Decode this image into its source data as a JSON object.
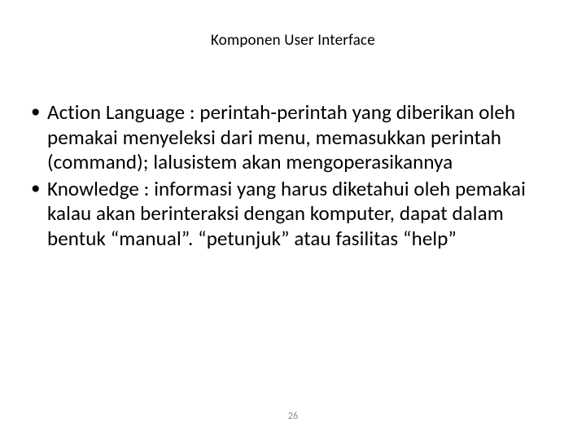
{
  "title": "Komponen User Interface",
  "bullets": [
    "Action Language : perintah-perintah yang diberikan oleh pemakai menyeleksi dari menu, memasukkan perintah (command); lalusistem akan mengoperasikannya",
    "Knowledge : informasi yang harus diketahui oleh pemakai kalau akan berinteraksi dengan komputer, dapat dalam bentuk “manual”. “petunjuk” atau fasilitas “help”"
  ],
  "pageNumber": "26"
}
